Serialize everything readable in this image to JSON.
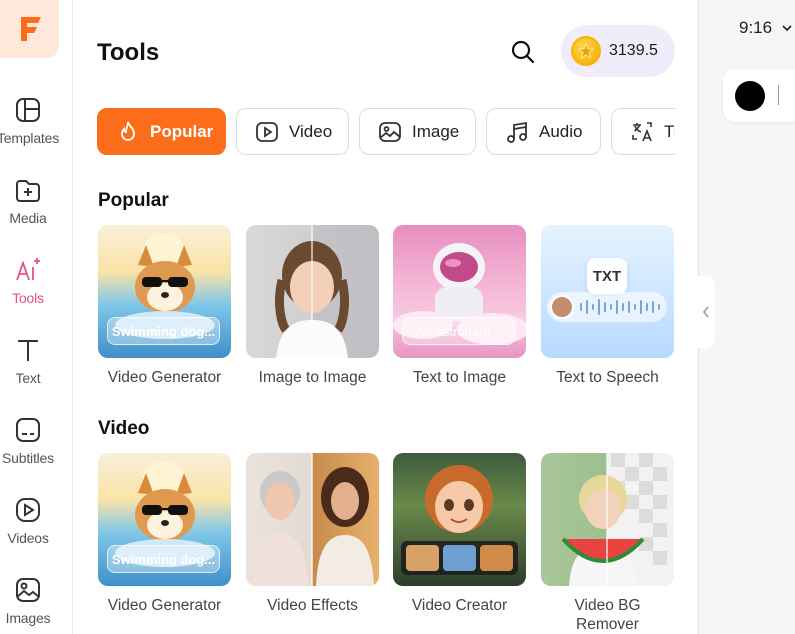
{
  "rail": {
    "items": [
      {
        "label": "Templates",
        "icon": "templates-icon"
      },
      {
        "label": "Media",
        "icon": "media-icon"
      },
      {
        "label": "Tools",
        "icon": "ai-tools-icon"
      },
      {
        "label": "Text",
        "icon": "text-icon"
      },
      {
        "label": "Subtitles",
        "icon": "subtitles-icon"
      },
      {
        "label": "Videos",
        "icon": "videos-icon"
      },
      {
        "label": "Images",
        "icon": "images-icon"
      }
    ],
    "active": "Tools"
  },
  "header": {
    "title": "Tools",
    "credits": "3139.5"
  },
  "tabs": [
    {
      "label": "Popular",
      "icon": "fire-icon",
      "active": true
    },
    {
      "label": "Video",
      "icon": "video-play-icon"
    },
    {
      "label": "Image",
      "icon": "image-icon"
    },
    {
      "label": "Audio",
      "icon": "music-note-icon"
    },
    {
      "label": "Tr",
      "icon": "translate-icon"
    }
  ],
  "sections": {
    "popular": {
      "title": "Popular",
      "cards": [
        {
          "label": "Video Generator",
          "overlay": "Swimming dog..."
        },
        {
          "label": "Image to Image"
        },
        {
          "label": "Text to Image",
          "overlay": "An astronaut..."
        },
        {
          "label": "Text to Speech",
          "badge": "TXT"
        }
      ]
    },
    "video": {
      "title": "Video",
      "cards": [
        {
          "label": "Video Generator",
          "overlay": "Swimming dog..."
        },
        {
          "label": "Video Effects"
        },
        {
          "label": "Video Creator"
        },
        {
          "label": "Video BG\nRemover"
        }
      ]
    }
  },
  "right_panel": {
    "aspect_ratio": "9:16"
  },
  "colors": {
    "accent": "#fb6c1b",
    "active_rail": "#e8527a",
    "credits_bg": "#f1ecfb"
  }
}
